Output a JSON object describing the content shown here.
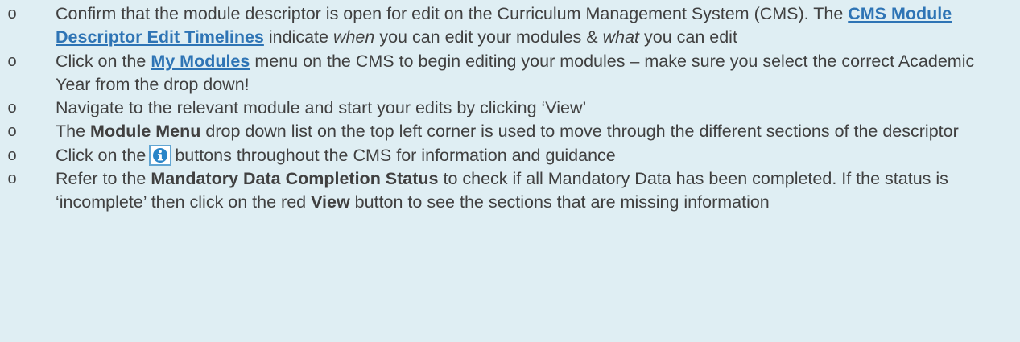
{
  "bullet_glyph": "o",
  "items": [
    {
      "pre": "Confirm that the module descriptor is open for edit on the Curriculum Management System (CMS). The ",
      "link": "CMS Module Descriptor Edit Timelines",
      "mid1": " indicate ",
      "em1": "when",
      "mid2": " you can edit your modules & ",
      "em2": "what",
      "post": " you can edit"
    },
    {
      "pre": "Click on the ",
      "link": "My Modules",
      "post": " menu on the CMS to begin editing your modules – make sure you select the correct Academic Year from the drop down!"
    },
    {
      "text": "Navigate to the relevant module and start your edits by clicking ‘View’"
    },
    {
      "pre": "The ",
      "bold": "Module Menu",
      "post": " drop down list on the top left corner is used to move through the different sections of the descriptor"
    },
    {
      "pre": "Click on the",
      "icon": "info-icon",
      "post": "buttons throughout the CMS for information and guidance"
    },
    {
      "pre": "Refer to the ",
      "bold": "Mandatory Data Completion Status",
      "mid": " to check if all Mandatory Data has been completed. If the status is ‘incomplete’ then click on the red ",
      "bold2": "View",
      "post": " button to see the sections that are missing information"
    }
  ],
  "colors": {
    "background": "#dfeef3",
    "text": "#404040",
    "link": "#2e74b5",
    "info_icon": "#2a85c8"
  }
}
